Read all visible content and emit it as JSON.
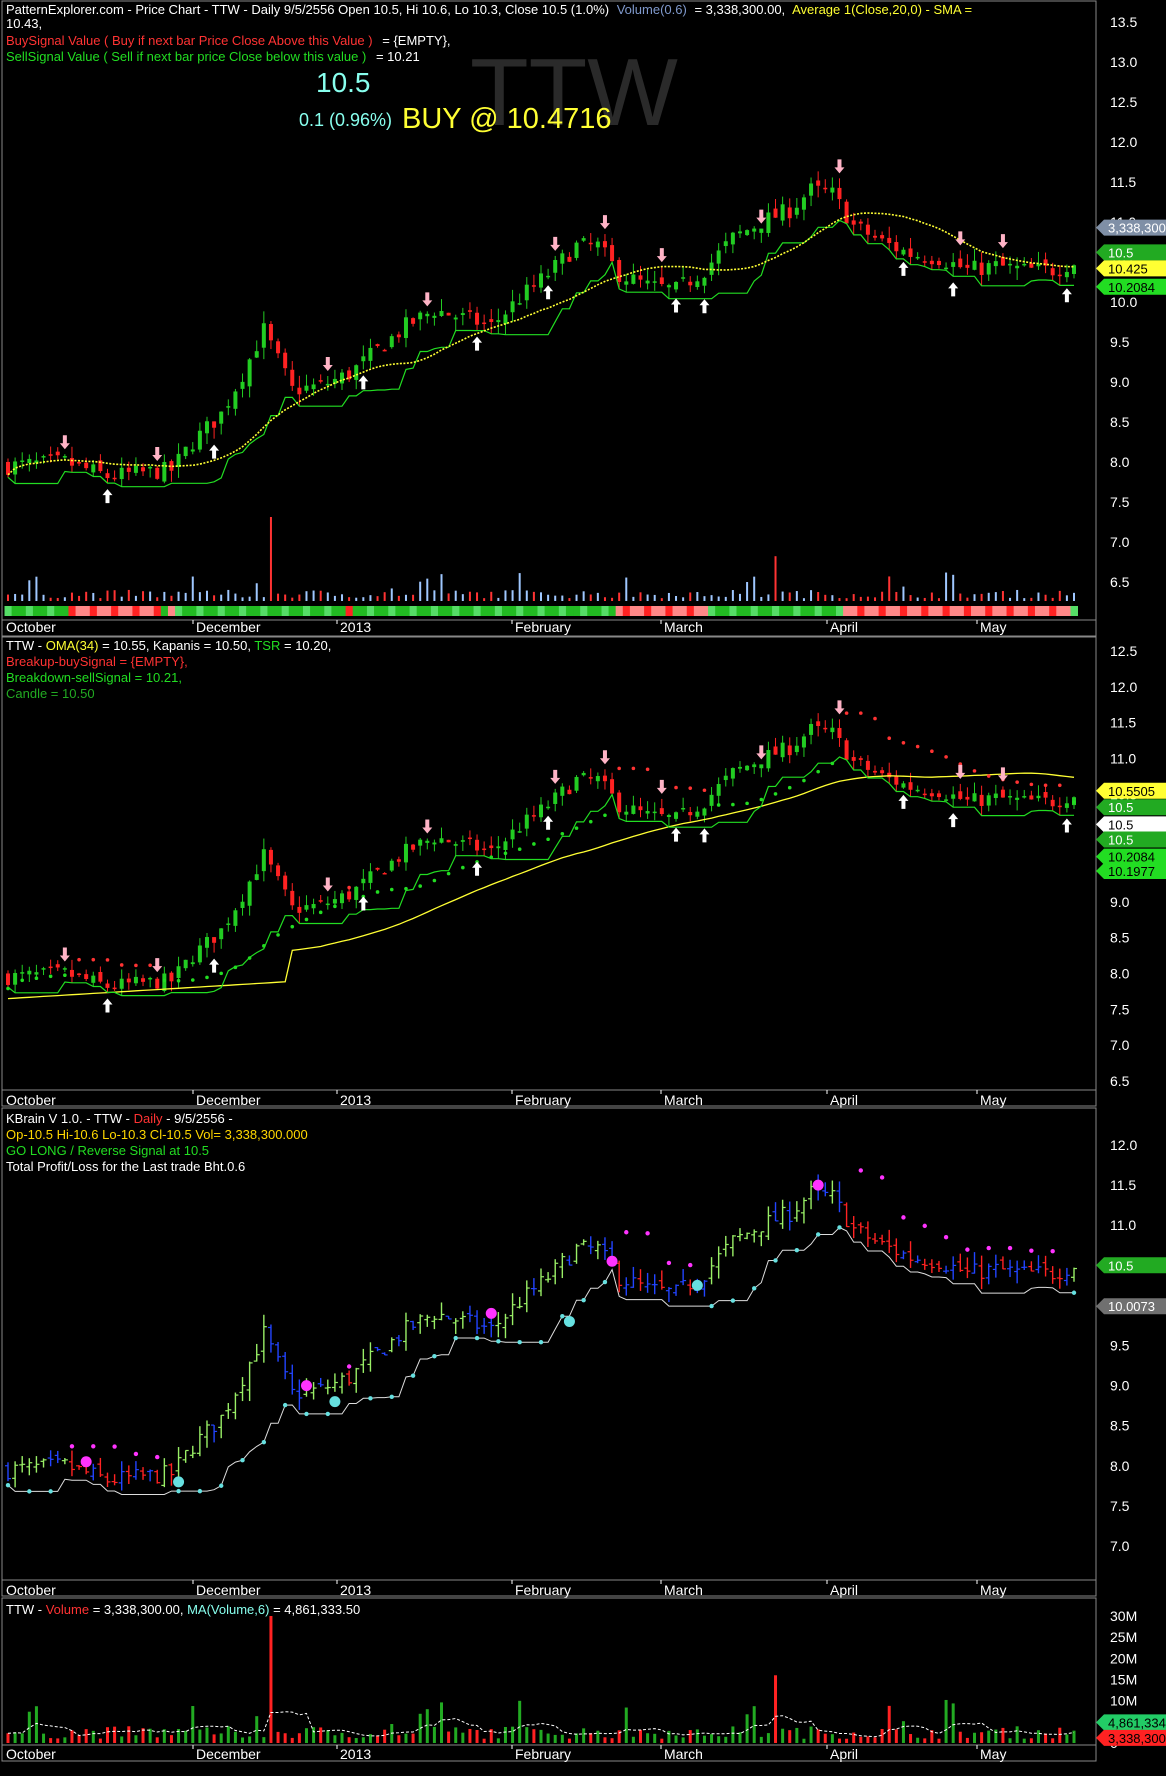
{
  "colors": {
    "background": "#000000",
    "up": "#22cc22",
    "down": "#ff2222",
    "sma": "#ffff33",
    "trail": "#22dd22",
    "resistance": "#ff3333",
    "cyan": "#66e0e0",
    "magenta": "#ff33ff",
    "blue": "#2244ff",
    "lime": "#99ee66",
    "border": "#888888",
    "gold": "#ffd700",
    "grey": "#707070"
  },
  "x_axis_labels": [
    "October",
    "December",
    "2013",
    "February",
    "March",
    "April",
    "May"
  ],
  "watermark": "TTW",
  "panel1": {
    "header": {
      "line1_a": "PatternExplorer.com - Price Chart - TTW - Daily 9/5/2556 Open 10.5, Hi 10.6, Lo 10.3, Close 10.5 (1.0%)",
      "line1_b": "Volume(0.6)",
      "line1_c": "= 3,338,300.00,",
      "line1_d": "Average 1(Close,20,0) - SMA =",
      "line2": "10.43,",
      "line3_a": "BuySignal Value ( Buy if next bar Price Close Above this Value )",
      "line3_b": "= {EMPTY},",
      "line4_a": "SellSignal Value ( Sell if next bar price Close below this value )",
      "line4_b": "= 10.21"
    },
    "price_big": "10.5",
    "change": "0.1 (0.96%)",
    "signal": "BUY  @ 10.4716",
    "y_ticks": [
      "13.5",
      "13.0",
      "12.5",
      "12.0",
      "11.5",
      "11.0",
      "10.5",
      "10.0",
      "9.5",
      "9.0",
      "8.5",
      "8.0",
      "7.5",
      "7.0",
      "6.5"
    ],
    "y_values": [
      13.5,
      13.0,
      12.5,
      12.0,
      11.5,
      11.0,
      10.5,
      10.0,
      9.5,
      9.0,
      8.5,
      8.0,
      7.5,
      7.0,
      6.5
    ],
    "badges": [
      {
        "text": "3,338,300",
        "value": 10.93,
        "bg": "#7f8fa6",
        "fg": "#ffffff"
      },
      {
        "text": "10.5",
        "value": 10.62,
        "bg": "#22aa22",
        "fg": "#ffffff"
      },
      {
        "text": "10.425",
        "value": 10.42,
        "bg": "#ffff33",
        "fg": "#000000"
      },
      {
        "text": "10.2084",
        "value": 10.19,
        "bg": "#22dd22",
        "fg": "#000000"
      }
    ]
  },
  "panel2": {
    "header": {
      "a": "TTW - ",
      "b": "OMA(34)",
      "c": " = 10.55, Kapanis = 10.50, ",
      "d": "TSR",
      "e": " = 10.20,",
      "line2": "Breakup-buySignal = {EMPTY},",
      "line3": "Breakdown-sellSignal = 10.21,",
      "line4": "Candle = 10.50"
    },
    "y_ticks": [
      "12.5",
      "12.0",
      "11.5",
      "11.0",
      "10.5",
      "10.0",
      "9.5",
      "9.0",
      "8.5",
      "8.0",
      "7.5",
      "7.0",
      "6.5"
    ],
    "y_values": [
      12.5,
      12.0,
      11.5,
      11.0,
      10.5,
      10.0,
      9.5,
      9.0,
      8.5,
      8.0,
      7.5,
      7.0,
      6.5
    ],
    "badges": [
      {
        "text": "10.5505",
        "value": 10.55,
        "bg": "#ffff33",
        "fg": "#000000"
      },
      {
        "text": "10.5",
        "value": 10.32,
        "bg": "#22aa22",
        "fg": "#ffffff"
      },
      {
        "text": "10.5",
        "value": 10.08,
        "bg": "#ffffff",
        "fg": "#000000"
      },
      {
        "text": "10.5",
        "value": 9.87,
        "bg": "#22aa22",
        "fg": "#ffffff"
      },
      {
        "text": "10.2084",
        "value": 9.63,
        "bg": "#22dd22",
        "fg": "#000000"
      },
      {
        "text": "10.1977",
        "value": 9.43,
        "bg": "#22dd22",
        "fg": "#000000"
      }
    ]
  },
  "panel3": {
    "header": {
      "line1_a": "KBrain V 1.0.  - TTW - ",
      "line1_b": "Daily",
      "line1_c": " - 9/5/2556 -",
      "line2": "Op-10.5  Hi-10.6  Lo-10.3  Cl-10.5  Vol= 3,338,300.000",
      "line3": " GO LONG / Reverse Signal at 10.5",
      "line4": "Total Profit/Loss for the Last trade Bht.0.6"
    },
    "y_ticks": [
      "12.0",
      "11.5",
      "11.0",
      "10.5",
      "10.0",
      "9.5",
      "9.0",
      "8.5",
      "8.0",
      "7.5",
      "7.0"
    ],
    "y_values": [
      12.0,
      11.5,
      11.0,
      10.5,
      10.0,
      9.5,
      9.0,
      8.5,
      8.0,
      7.5,
      7.0
    ],
    "badges": [
      {
        "text": "10.5",
        "value": 10.5,
        "bg": "#22aa22",
        "fg": "#ffffff"
      },
      {
        "text": "10.0073",
        "value": 9.99,
        "bg": "#707070",
        "fg": "#ffffff"
      }
    ]
  },
  "panel4": {
    "header": {
      "a": "TTW - ",
      "b": "Volume",
      "c": " = 3,338,300.00, ",
      "d": "MA(Volume,6)",
      "e": " = 4,861,333.50"
    },
    "y_ticks": [
      "30M",
      "25M",
      "20M",
      "15M",
      "10M",
      "5M",
      "0"
    ],
    "y_values": [
      30,
      25,
      20,
      15,
      10,
      5,
      0
    ],
    "badges": [
      {
        "text": "4,861,334",
        "value": 4.86,
        "bg": "#22cc66",
        "fg": "#000000"
      },
      {
        "text": "3,338,300",
        "value": 1.2,
        "bg": "#ff2222",
        "fg": "#000000"
      }
    ]
  },
  "chart_data": {
    "type": "candlestick",
    "symbol": "TTW",
    "interval": "Daily",
    "x_labels": [
      "October",
      "December",
      "2013",
      "February",
      "March",
      "April",
      "May"
    ],
    "last_bar": {
      "date": "9/5/2556",
      "open": 10.5,
      "high": 10.6,
      "low": 10.3,
      "close": 10.5,
      "volume": 3338300
    },
    "indicators": {
      "sma20": 10.43,
      "sell_signal": 10.21,
      "oma34": 10.55,
      "tsr": 10.2,
      "volume_ma6": 4861333.5
    },
    "ylim_price": [
      6.5,
      13.5
    ],
    "ylim_volume": [
      0,
      30
    ],
    "close_path": [
      {
        "i": 0,
        "close": 7.95
      },
      {
        "i": 8,
        "close": 8.0
      },
      {
        "i": 14,
        "close": 7.82
      },
      {
        "i": 23,
        "close": 7.9
      },
      {
        "i": 26,
        "close": 8.25
      },
      {
        "i": 30,
        "close": 8.6
      },
      {
        "i": 33,
        "close": 9.1
      },
      {
        "i": 36,
        "close": 9.65
      },
      {
        "i": 40,
        "close": 8.9
      },
      {
        "i": 44,
        "close": 8.95
      },
      {
        "i": 48,
        "close": 9.1
      },
      {
        "i": 52,
        "close": 9.4
      },
      {
        "i": 56,
        "close": 9.7
      },
      {
        "i": 60,
        "close": 9.9
      },
      {
        "i": 64,
        "close": 9.8
      },
      {
        "i": 68,
        "close": 9.7
      },
      {
        "i": 72,
        "close": 10.05
      },
      {
        "i": 76,
        "close": 10.35
      },
      {
        "i": 80,
        "close": 10.7
      },
      {
        "i": 83,
        "close": 10.7
      },
      {
        "i": 86,
        "close": 10.35
      },
      {
        "i": 90,
        "close": 10.2
      },
      {
        "i": 94,
        "close": 10.15
      },
      {
        "i": 98,
        "close": 10.4
      },
      {
        "i": 102,
        "close": 10.8
      },
      {
        "i": 106,
        "close": 11.0
      },
      {
        "i": 110,
        "close": 11.15
      },
      {
        "i": 113,
        "close": 11.4
      },
      {
        "i": 116,
        "close": 11.35
      },
      {
        "i": 119,
        "close": 10.95
      },
      {
        "i": 123,
        "close": 10.75
      },
      {
        "i": 127,
        "close": 10.6
      },
      {
        "i": 131,
        "close": 10.55
      },
      {
        "i": 135,
        "close": 10.4
      },
      {
        "i": 139,
        "close": 10.45
      },
      {
        "i": 143,
        "close": 10.4
      },
      {
        "i": 147,
        "close": 10.4
      },
      {
        "i": 150,
        "close": 10.5
      }
    ]
  }
}
